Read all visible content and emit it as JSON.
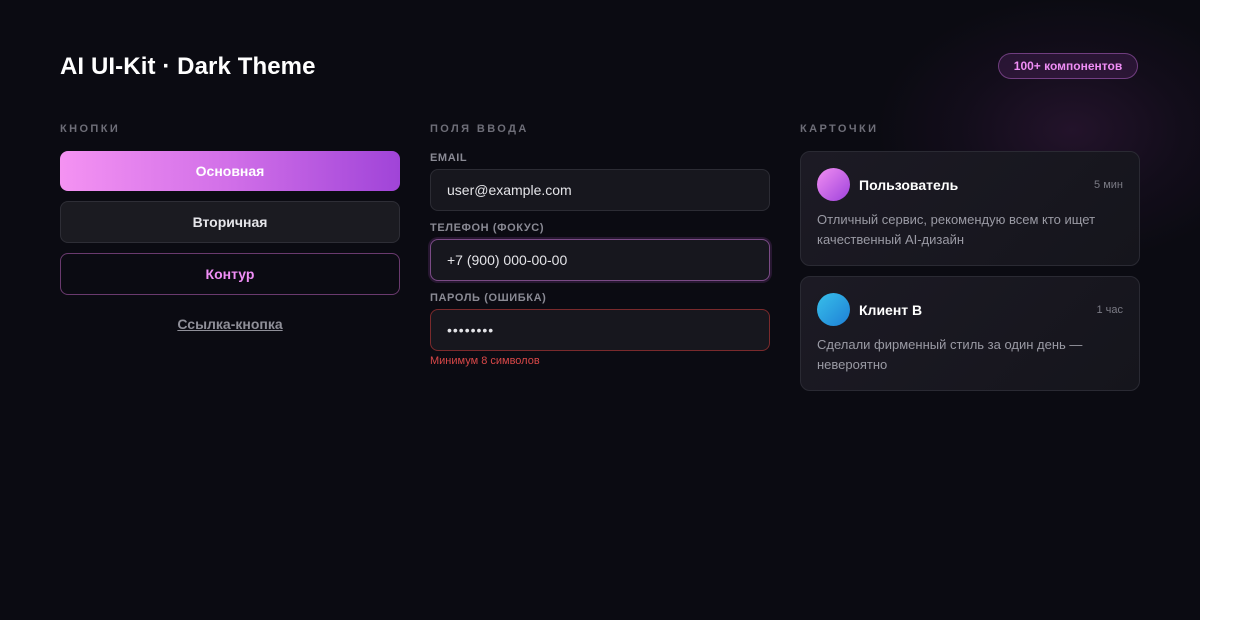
{
  "header": {
    "title": "AI UI-Kit · Dark Theme",
    "badge": "100+ компонентов"
  },
  "buttons": {
    "heading": "КНОПКИ",
    "primary": "Основная",
    "secondary": "Вторичная",
    "outline": "Контур",
    "link": "Ссылка-кнопка"
  },
  "inputs": {
    "heading": "ПОЛЯ ВВОДА",
    "email": {
      "label": "EMAIL",
      "value": "user@example.com"
    },
    "phone": {
      "label": "ТЕЛЕФОН (ФОКУС)",
      "value": "+7 (900) 000-00-00"
    },
    "password": {
      "label": "ПАРОЛЬ (ОШИБКА)",
      "value": "••••••••",
      "error": "Минимум 8 символов"
    }
  },
  "cards": {
    "heading": "КАРТОЧКИ",
    "items": [
      {
        "name": "Пользователь",
        "time": "5 мин",
        "text": "Отличный сервис, рекомендую всем кто ищет качественный AI-дизайн"
      },
      {
        "name": "Клиент B",
        "time": "1 час",
        "text": "Сделали фирменный стиль за один день — невероятно"
      }
    ]
  },
  "colors": {
    "background": "#0b0b12",
    "accent": "#f08ef6",
    "primary_gradient_start": "#f492f2",
    "primary_gradient_end": "#a044d8",
    "error": "#d94848"
  }
}
